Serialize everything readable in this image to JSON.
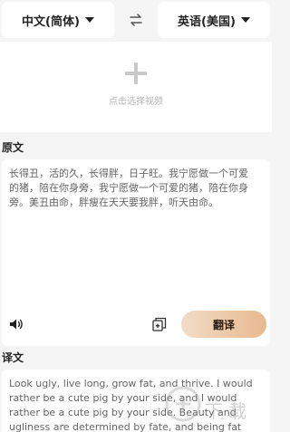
{
  "language_bar": {
    "source_language": "中文(简体)",
    "target_language": "英语(美国)",
    "swap_icon": "swap-arrows-icon"
  },
  "upload": {
    "icon": "plus-icon",
    "label": "点击选择视频"
  },
  "source": {
    "section_title": "原文",
    "text": "长得丑，活的久，长得胖，日子旺。我宁愿做一个可爱的猪，陪在你身旁，我宁愿做一个可爱的猪，陪在你身旁。美丑由命，胖瘦在天天要我胖，听天由命。",
    "speaker_icon": "speaker-icon",
    "copy_icon": "copy-icon",
    "translate_button": "翻译"
  },
  "target": {
    "section_title": "译文",
    "text": "Look ugly, live long, grow fat, and thrive. I would rather be a cute pig by your side, and I would rather be a cute pig by your side. Beauty and ugliness are determined by fate, and being fat"
  },
  "watermark": {
    "text": "下载"
  },
  "colors": {
    "background": "#f5f5f5",
    "card": "#ffffff",
    "button_gradient_start": "#f2dcc6",
    "button_gradient_end": "#e7b98f"
  }
}
